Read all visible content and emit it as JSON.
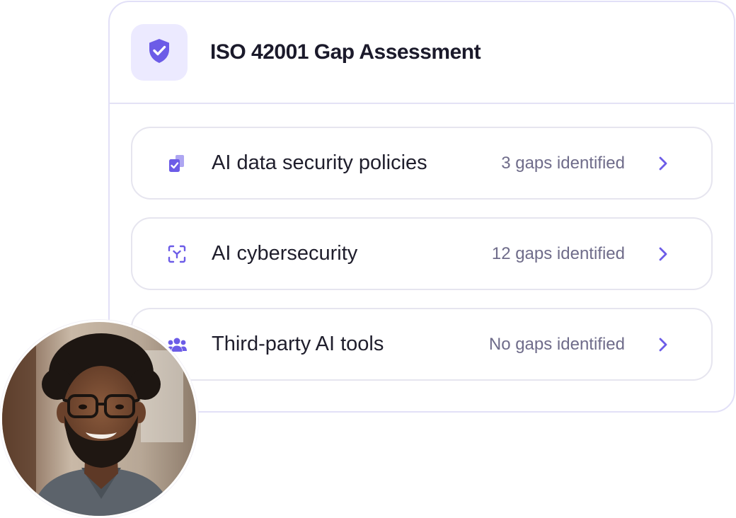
{
  "card": {
    "title": "ISO 42001 Gap Assessment",
    "header_icon": "shield-check-icon"
  },
  "items": [
    {
      "icon": "clipboard-check-icon",
      "label": "AI data security policies",
      "status": "3 gaps identified"
    },
    {
      "icon": "scan-target-icon",
      "label": "AI cybersecurity",
      "status": "12 gaps identified"
    },
    {
      "icon": "users-group-icon",
      "label": "Third-party AI tools",
      "status": "No gaps identified"
    }
  ],
  "colors": {
    "accent": "#6c5ce7",
    "tile_bg": "#eceaff",
    "border": "#e4e2f5",
    "status_text": "#6f6c8a"
  }
}
